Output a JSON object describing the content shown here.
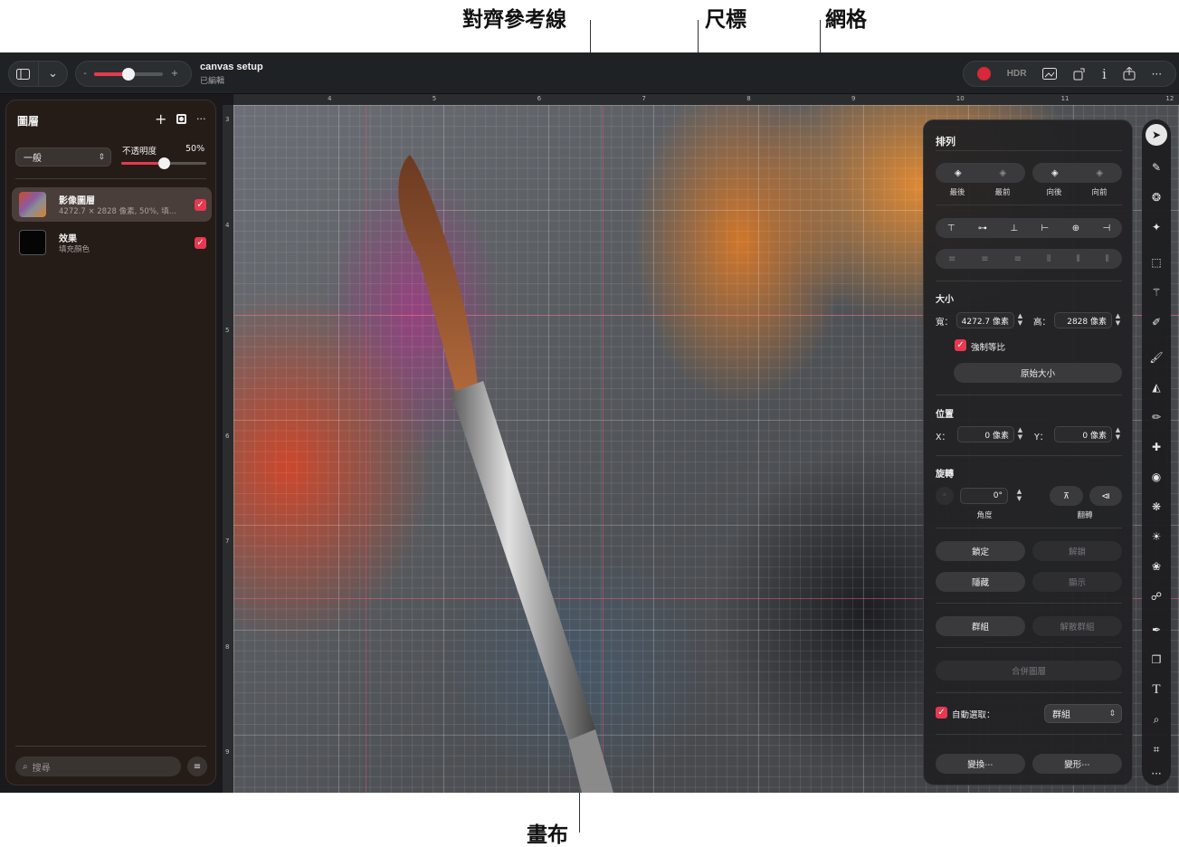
{
  "callouts": {
    "guides": "對齊參考線",
    "rulers": "尺標",
    "grid": "網格",
    "canvas": "畫布"
  },
  "toolbar": {
    "doc_title": "canvas setup",
    "doc_subtitle": "已編輯",
    "zoom_minus": "-",
    "zoom_plus": "+",
    "zoom_level": 0.5,
    "hdr_label": "HDR",
    "info_label": "i",
    "more_label": "···"
  },
  "rulers": {
    "top": [
      "4",
      "5",
      "6",
      "7",
      "8",
      "9",
      "10",
      "11",
      "12"
    ],
    "left": [
      "3",
      "4",
      "5",
      "6",
      "7",
      "8",
      "9"
    ]
  },
  "layers_panel": {
    "title": "圖層",
    "add_label": "+",
    "more_label": "···",
    "blend_mode": "一般",
    "opacity_label": "不透明度",
    "opacity_value": "50%",
    "opacity_fraction": 0.5,
    "layers": [
      {
        "name": "影像圖層",
        "detail": "4272.7 × 2828 像素, 50%, 填...",
        "checked": true
      },
      {
        "name": "效果",
        "detail": "填充顏色",
        "checked": true
      }
    ],
    "search_placeholder": "搜尋"
  },
  "arrange_panel": {
    "title": "排列",
    "order_buttons": [
      "最後",
      "最前",
      "向後",
      "向前"
    ],
    "size_title": "大小",
    "width_label": "寬：",
    "width_value": "4272.7 像素",
    "height_label": "高：",
    "height_value": "2828 像素",
    "constrain_label": "強制等比",
    "original_size_label": "原始大小",
    "position_title": "位置",
    "x_label": "X：",
    "x_value": "0 像素",
    "y_label": "Y：",
    "y_value": "0 像素",
    "rotation_title": "旋轉",
    "angle_value": "0°",
    "angle_label": "角度",
    "flip_label": "翻轉",
    "lock_label": "鎖定",
    "unlock_label": "解鎖",
    "hide_label": "隱藏",
    "show_label": "顯示",
    "group_label": "群組",
    "ungroup_label": "解散群組",
    "merge_label": "合併圖層",
    "auto_select_label": "自動選取：",
    "auto_select_value": "群組",
    "transform_label": "變換⋯",
    "distort_label": "變形⋯"
  },
  "tools_more": "···",
  "colors": {
    "accent": "#e8384f",
    "record": "#d8283a",
    "panel": "#222224"
  }
}
